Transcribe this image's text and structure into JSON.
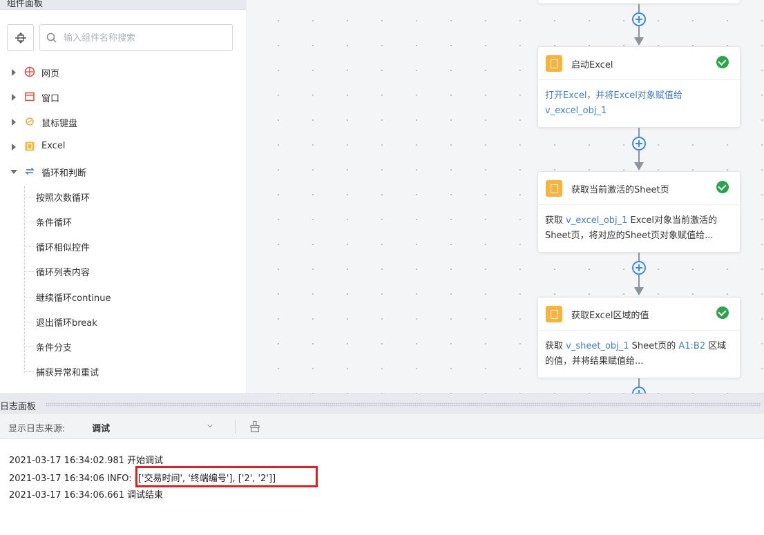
{
  "component_panel": {
    "title": "组件面板",
    "search": {
      "placeholder": "输入组件名称搜索",
      "value": ""
    },
    "categories": [
      {
        "label": "网页",
        "icon": "globe-icon",
        "color": "#e0463f",
        "expanded": false
      },
      {
        "label": "窗口",
        "icon": "window-icon",
        "color": "#e0463f",
        "expanded": false
      },
      {
        "label": "鼠标键盘",
        "icon": "mouse-keyboard-icon",
        "color": "#f2a43a",
        "expanded": false
      },
      {
        "label": "Excel",
        "icon": "excel-icon",
        "color": "#f8b43a",
        "expanded": false
      },
      {
        "label": "循环和判断",
        "icon": "loop-icon",
        "color": "#3a6ee8",
        "expanded": true
      }
    ],
    "loop_children": [
      "按照次数循环",
      "条件循环",
      "循环相似控件",
      "循环列表内容",
      "继续循环continue",
      "退出循环break",
      "条件分支",
      "捕获异常和重试"
    ]
  },
  "flow": {
    "cards": [
      {
        "title": "启动Excel",
        "status": "success",
        "body": [
          {
            "text": "打开Excel，并将Excel对象赋值给",
            "var": true
          },
          {
            "text": "v_excel_obj_1",
            "var": true
          }
        ]
      },
      {
        "title": "获取当前激活的Sheet页",
        "status": "success",
        "body": [
          {
            "text": "获取 ",
            "var": false
          },
          {
            "text": "v_excel_obj_1",
            "var": true
          },
          {
            "text": " Excel对象当前激活的Sheet页，将对应的Sheet页对象赋值给...",
            "var": false
          }
        ]
      },
      {
        "title": "获取Excel区域的值",
        "status": "success",
        "body": [
          {
            "text": "获取 ",
            "var": false
          },
          {
            "text": "v_sheet_obj_1",
            "var": true
          },
          {
            "text": " Sheet页的 ",
            "var": false
          },
          {
            "text": "A1:B2",
            "var": true
          },
          {
            "text": " 区域的值，并将结果赋值给...",
            "var": false
          }
        ]
      }
    ]
  },
  "log_panel": {
    "title": "日志面板",
    "source_label": "显示日志来源:",
    "source_value": "调试",
    "lines": [
      "2021-03-17 16:34:02.981 开始调试",
      "2021-03-17 16:34:06 INFO: [['交易时间', '终端编号'], ['2', '2']]",
      "2021-03-17 16:34:06.661 调试结束"
    ]
  },
  "colors": {
    "accent_blue": "#3a8be8",
    "success_green": "#2aa54a",
    "excel_orange": "#f8b43a",
    "highlight_red": "#e51d1d",
    "variable_blue": "#3f7fc9"
  }
}
